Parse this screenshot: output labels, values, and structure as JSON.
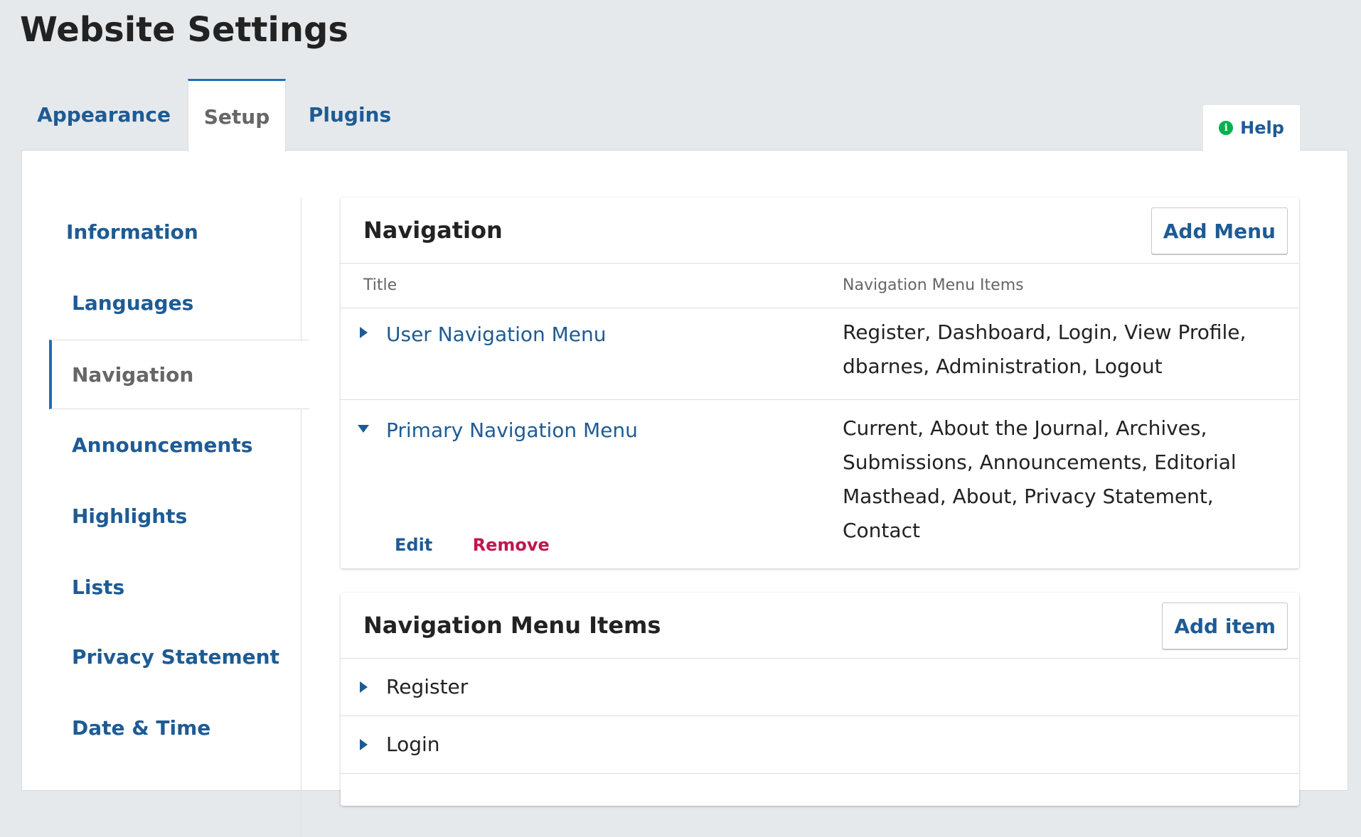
{
  "page": {
    "title": "Website Settings"
  },
  "tabs": [
    {
      "label": "Appearance"
    },
    {
      "label": "Setup"
    },
    {
      "label": "Plugins"
    }
  ],
  "help": {
    "label": "Help",
    "icon": "info-icon"
  },
  "sidebar": {
    "items": [
      {
        "label": "Information"
      },
      {
        "label": "Languages"
      },
      {
        "label": "Navigation"
      },
      {
        "label": "Announcements"
      },
      {
        "label": "Highlights"
      },
      {
        "label": "Lists"
      },
      {
        "label": "Privacy Statement"
      },
      {
        "label": "Date & Time"
      }
    ],
    "active": "Navigation"
  },
  "navigation_card": {
    "title": "Navigation",
    "add_button": "Add Menu",
    "columns": {
      "title": "Title",
      "items": "Navigation Menu Items"
    },
    "rows": [
      {
        "title": "User Navigation Menu",
        "items": "Register, Dashboard, Login, View Profile, dbarnes, Administration, Logout",
        "expanded": false
      },
      {
        "title": "Primary Navigation Menu",
        "items": "Current, About the Journal, Archives, Submissions, Announcements, Editorial Masthead, About, Privacy Statement, Contact",
        "expanded": true,
        "actions": {
          "edit": "Edit",
          "remove": "Remove"
        }
      }
    ]
  },
  "menu_items_card": {
    "title": "Navigation Menu Items",
    "add_button": "Add item",
    "items": [
      {
        "label": "Register"
      },
      {
        "label": "Login"
      }
    ]
  },
  "colors": {
    "link": "#1e5b94",
    "accent": "#1e6fba",
    "danger": "#c0164b",
    "help_icon": "#00b24e",
    "page_bg": "#e6e9eb"
  }
}
